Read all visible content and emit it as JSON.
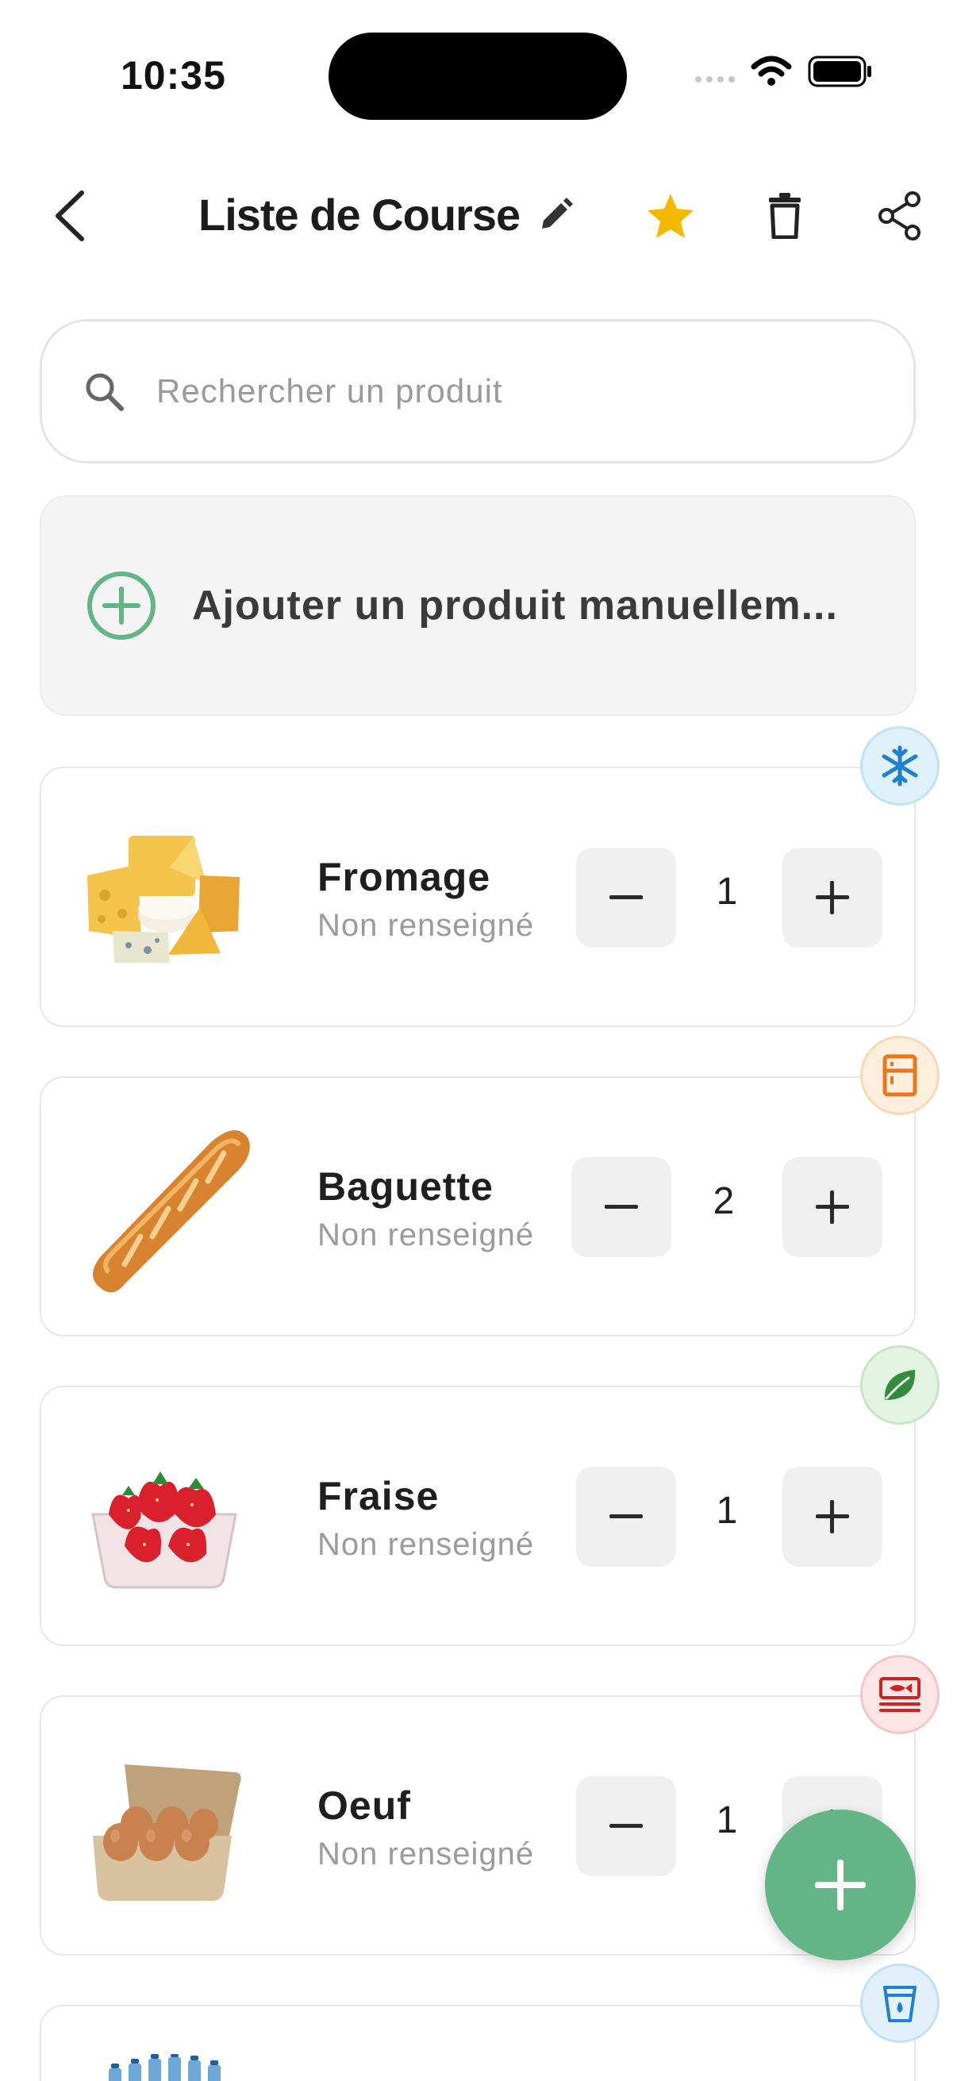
{
  "status": {
    "time": "10:35"
  },
  "header": {
    "title": "Liste de Course"
  },
  "search": {
    "placeholder": "Rechercher un produit"
  },
  "manual": {
    "label": "Ajouter un produit manuellem..."
  },
  "products": [
    {
      "name": "Fromage",
      "subtitle": "Non renseigné",
      "quantity": "1",
      "badge": "snowflake-icon"
    },
    {
      "name": "Baguette",
      "subtitle": "Non renseigné",
      "quantity": "2",
      "badge": "fridge-icon"
    },
    {
      "name": "Fraise",
      "subtitle": "Non renseigné",
      "quantity": "1",
      "badge": "leaf-icon"
    },
    {
      "name": "Oeuf",
      "subtitle": "Non renseigné",
      "quantity": "1",
      "badge": "fish-icon"
    }
  ],
  "colors": {
    "accent": "#63b586",
    "star": "#f5b800"
  }
}
